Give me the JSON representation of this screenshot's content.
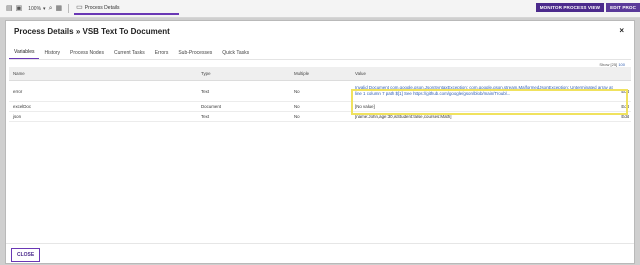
{
  "topbar": {
    "zoom": "100%",
    "tab_label": "Process Details",
    "buttons": {
      "monitor": "MONITOR PROCESS VIEW",
      "edit": "EDIT PROC"
    }
  },
  "modal": {
    "title": "Process Details » VSB Text To Document",
    "close_icon": "×",
    "tabs": [
      "Variables",
      "History",
      "Process Nodes",
      "Current Tasks",
      "Errors",
      "Sub-Processes",
      "Quick Tasks"
    ],
    "active_tab": "Variables",
    "show": {
      "label": "Show",
      "current": "[25]",
      "other": "100"
    },
    "columns": [
      "Name",
      "Type",
      "Multiple",
      "Value"
    ],
    "rows": [
      {
        "name": "error",
        "type": "Text",
        "multiple": "No",
        "value": "Invalid Document com.google.gson.JsonSyntaxException: com.google.gson.stream.MalformedJsonException: Unterminated array at line 1 column 7 path $[1] See https://github.com/google/gson/blob/main/Troubl...",
        "edit": "Edit"
      },
      {
        "name": "excelDoc",
        "type": "Document",
        "multiple": "No",
        "value": "[No value]",
        "edit": "Edit"
      },
      {
        "name": "json",
        "type": "Text",
        "multiple": "No",
        "value": "[name:John,age:30,isStudent:false,courses:Math]",
        "edit": "Edit"
      }
    ],
    "close_button": "CLOSE"
  }
}
